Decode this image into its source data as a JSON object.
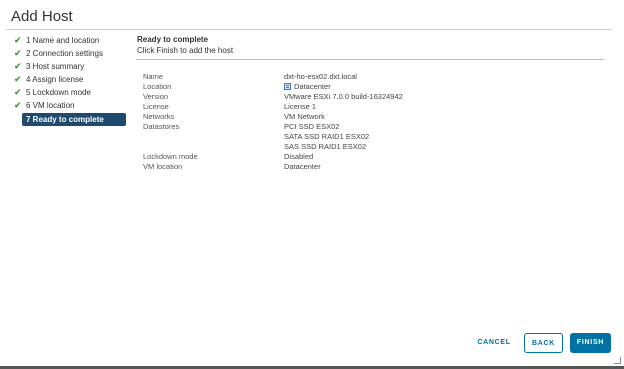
{
  "dialog": {
    "title": "Add Host"
  },
  "steps": [
    {
      "label": "1 Name and location",
      "done": true
    },
    {
      "label": "2 Connection settings",
      "done": true
    },
    {
      "label": "3 Host summary",
      "done": true
    },
    {
      "label": "4 Assign license",
      "done": true
    },
    {
      "label": "5 Lockdown mode",
      "done": true
    },
    {
      "label": "6 VM location",
      "done": true
    },
    {
      "label": "7 Ready to complete",
      "done": false,
      "active": true
    }
  ],
  "main": {
    "title": "Ready to complete",
    "subtitle": "Click Finish to add the host",
    "summary": {
      "name_key": "Name",
      "name_value": "dxt-ho-esx02.dxt.local",
      "location_key": "Location",
      "location_value": "Datacenter",
      "version_key": "Version",
      "version_value": "VMware ESXi 7.0.0 build-16324942",
      "license_key": "License",
      "license_value": "License 1",
      "networks_key": "Networks",
      "networks_value": "VM Network",
      "datastores_key": "Datastores",
      "datastores_values": [
        "PCI SSD ESX02",
        "SATA SSD RAID1 ESX02",
        "SAS SSD RAID1 ESX02"
      ],
      "lockdown_key": "Lockdown mode",
      "lockdown_value": "Disabled",
      "vmlocation_key": "VM location",
      "vmlocation_value": "Datacenter"
    }
  },
  "footer": {
    "cancel_label": "CANCEL",
    "back_label": "BACK",
    "finish_label": "FINISH"
  },
  "colors": {
    "primary": "#0072a3",
    "active_step": "#1d4a6e",
    "check": "#2e8b2e"
  },
  "icons": {
    "step_done": "checkmark-icon",
    "location": "datacenter-icon"
  }
}
